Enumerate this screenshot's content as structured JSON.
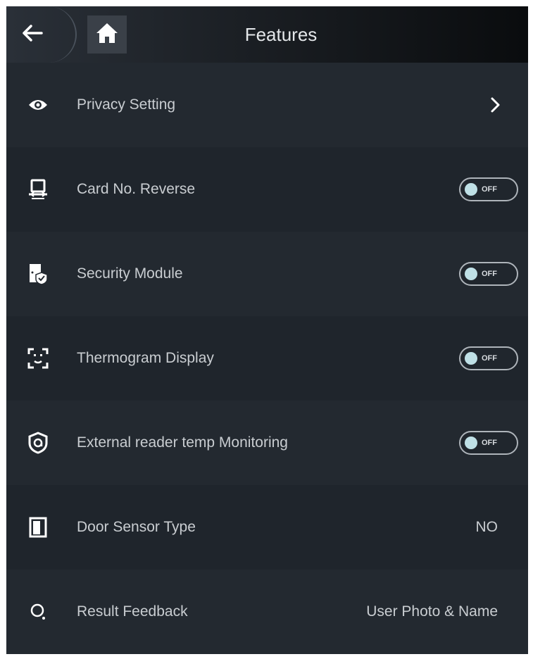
{
  "header": {
    "title": "Features",
    "back_icon": "arrow-left-icon",
    "home_icon": "home-icon"
  },
  "colors": {
    "background": "#1f252c",
    "row_alt": "#232930",
    "text": "#c9cdd1",
    "toggle_knob": "#bfe0e6"
  },
  "rows": [
    {
      "label": "Privacy Setting",
      "icon": "eye-icon",
      "control": "chevron"
    },
    {
      "label": "Card No. Reverse",
      "icon": "card-reverse-icon",
      "control": "toggle",
      "toggle_text": "OFF"
    },
    {
      "label": "Security Module",
      "icon": "security-module-icon",
      "control": "toggle",
      "toggle_text": "OFF"
    },
    {
      "label": "Thermogram Display",
      "icon": "face-scan-icon",
      "control": "toggle",
      "toggle_text": "OFF"
    },
    {
      "label": "External reader temp Monitoring",
      "icon": "shield-temp-icon",
      "control": "toggle",
      "toggle_text": "OFF"
    },
    {
      "label": "Door Sensor Type",
      "icon": "door-icon",
      "control": "value",
      "value": "NO"
    },
    {
      "label": "Result Feedback",
      "icon": "feedback-icon",
      "control": "value",
      "value": "User Photo & Name"
    }
  ]
}
